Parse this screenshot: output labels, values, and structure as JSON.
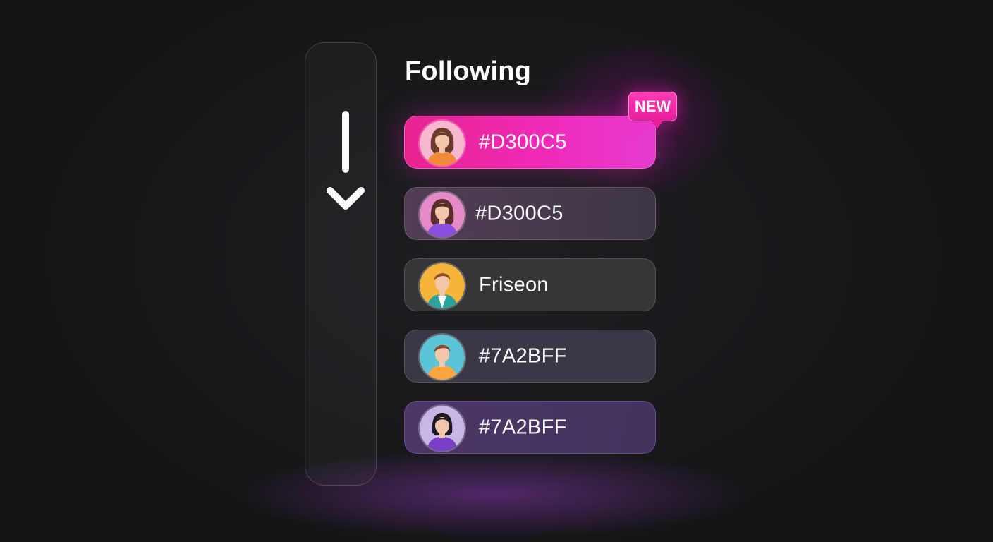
{
  "header": {
    "title": "Following"
  },
  "badge": {
    "label": "NEW",
    "color": "#E8229E"
  },
  "scroll_indicator": {
    "icon": "arrow-down-icon"
  },
  "following": [
    {
      "label": "#D300C5",
      "state": "active",
      "avatar": "avatar-woman-brown-hair-orange-top",
      "color": "#EE28B0"
    },
    {
      "label": "#D300C5",
      "state": "default",
      "avatar": "avatar-woman-brown-hair-purple-top",
      "color": "#54435B"
    },
    {
      "label": "Friseon",
      "state": "default",
      "avatar": "avatar-man-brown-hair-teal-jacket",
      "color": "#38383C"
    },
    {
      "label": "#7A2BFF",
      "state": "default",
      "avatar": "avatar-man-brown-hair-orange-top",
      "color": "#3E3A48"
    },
    {
      "label": "#7A2BFF",
      "state": "default",
      "avatar": "avatar-woman-black-hair-purple-top",
      "color": "#4C3A6C"
    }
  ]
}
